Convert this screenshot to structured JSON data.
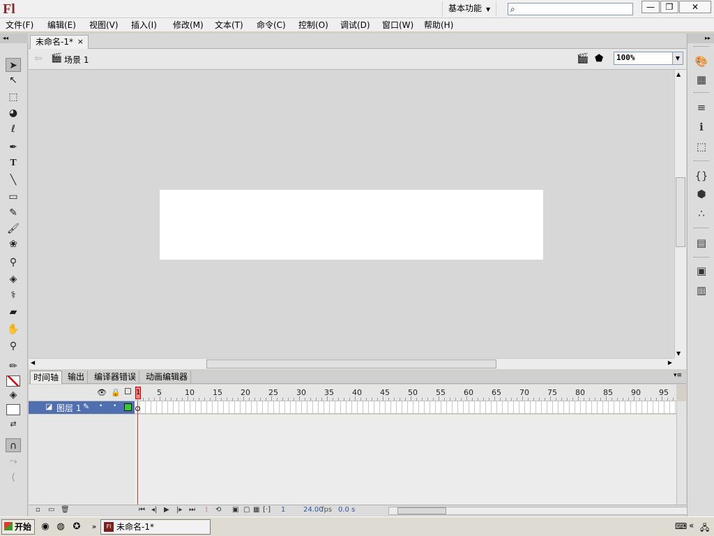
{
  "app": {
    "logo": "Fl",
    "workspace_label": "基本功能",
    "search_placeholder": ""
  },
  "window_buttons": {
    "minimize": "—",
    "maximize": "❐",
    "close": "✕"
  },
  "menu": [
    "文件(F)",
    "编辑(E)",
    "视图(V)",
    "插入(I)",
    "修改(M)",
    "文本(T)",
    "命令(C)",
    "控制(O)",
    "调试(D)",
    "窗口(W)",
    "帮助(H)"
  ],
  "document_tab": {
    "title": "未命名-1*",
    "close": "×"
  },
  "editbar": {
    "scene_label": "场景 1",
    "zoom": "100%"
  },
  "panel_tabs": [
    "时间轴",
    "输出",
    "编译器错误",
    "动画编辑器"
  ],
  "timeline": {
    "current_frame_marker": "1",
    "ruler_numbers": [
      "5",
      "10",
      "15",
      "20",
      "25",
      "30",
      "35",
      "40",
      "45",
      "50",
      "55",
      "60",
      "65",
      "70",
      "75",
      "80",
      "85",
      "90",
      "95"
    ],
    "layer_name": "图层 1",
    "status": {
      "frame": "1",
      "fps": "24.00",
      "fps_unit": "fps",
      "time": "0.0 s"
    }
  },
  "taskbar": {
    "start_label": "开始",
    "task_item": "未命名-1*",
    "chevron": "»"
  },
  "colors": {
    "stage": "#ffffff",
    "pasteboard": "#d7d7d7",
    "layer_selected": "#4f6fb0",
    "playhead": "#e03030",
    "outline_color": "#33cc33"
  }
}
